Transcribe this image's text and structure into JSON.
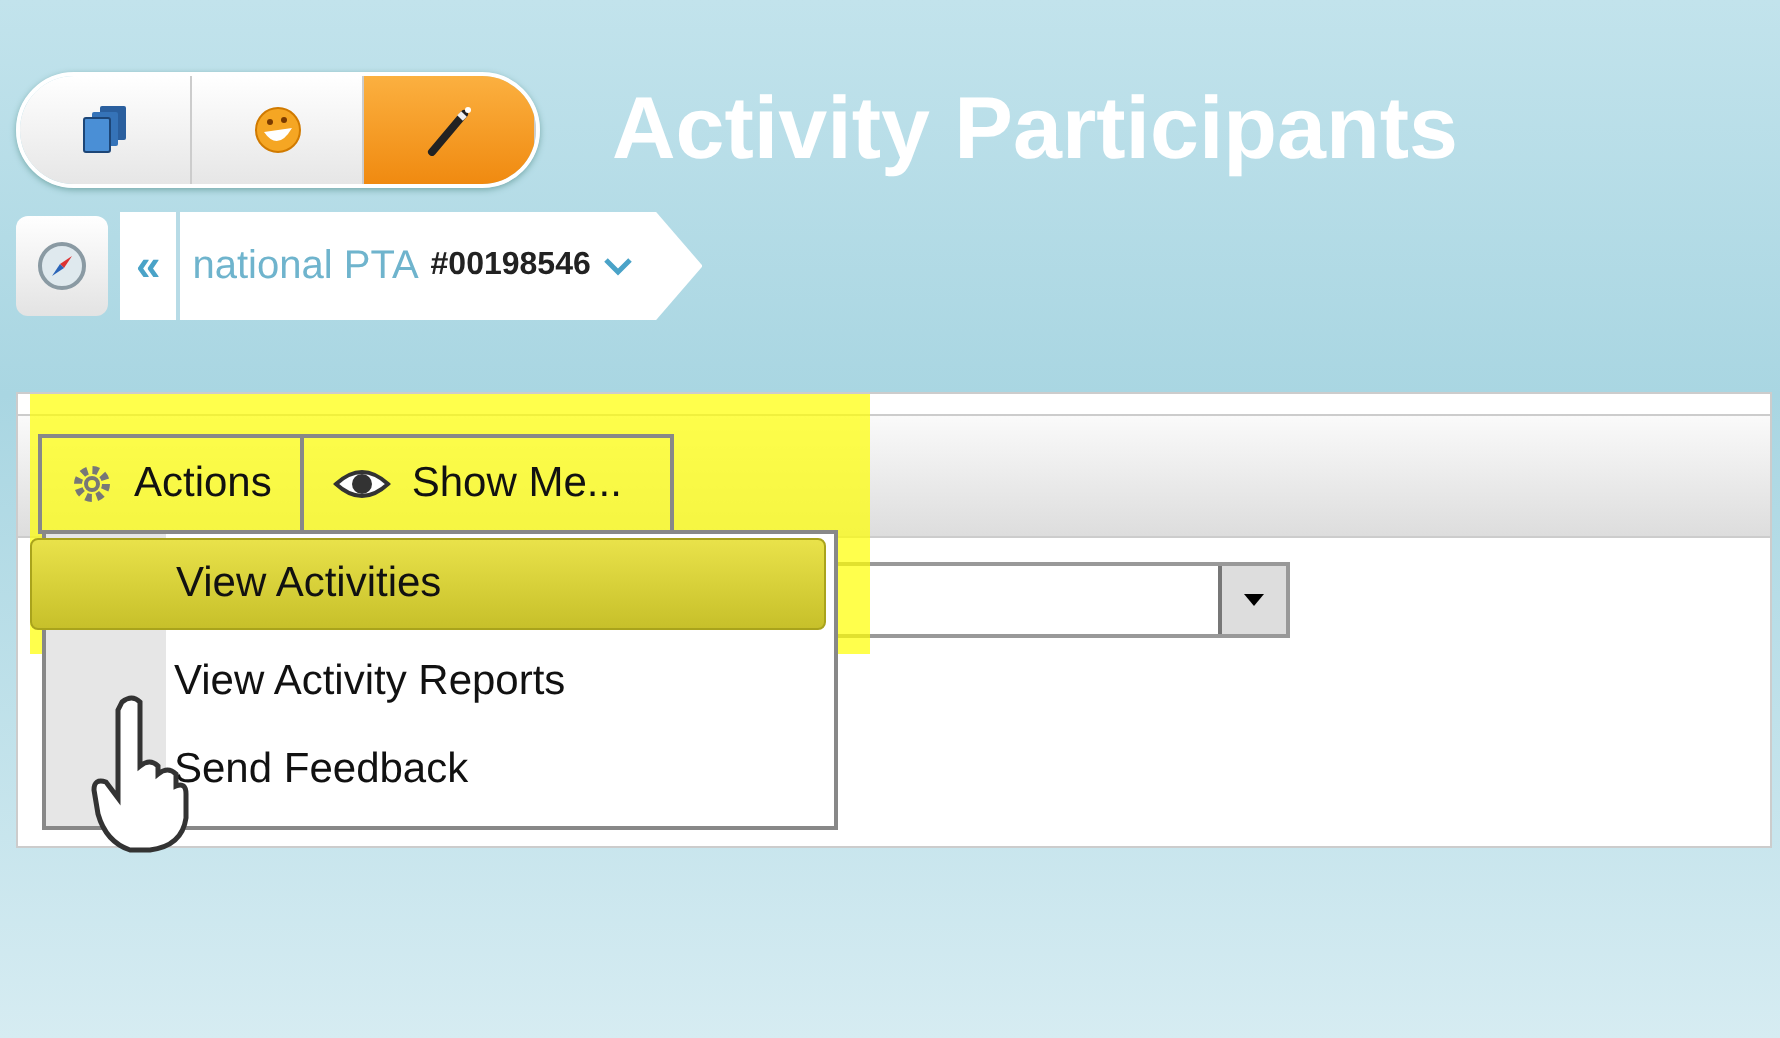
{
  "app_tabs": [
    {
      "selected": false
    },
    {
      "selected": false
    },
    {
      "selected": true
    }
  ],
  "title": "Activity Participants",
  "breadcrumb": {
    "back": "«",
    "name": "national PTA",
    "number": "#00198546"
  },
  "toolbar": [
    {
      "label": "Actions",
      "kind": "gear"
    },
    {
      "label": "Show Me...",
      "kind": "eye"
    }
  ],
  "actions_menu": [
    {
      "label": "View Activities",
      "selected": true
    },
    {
      "label": "View Activity Reports",
      "selected": false
    },
    {
      "label": "Send Feedback",
      "selected": false
    }
  ]
}
